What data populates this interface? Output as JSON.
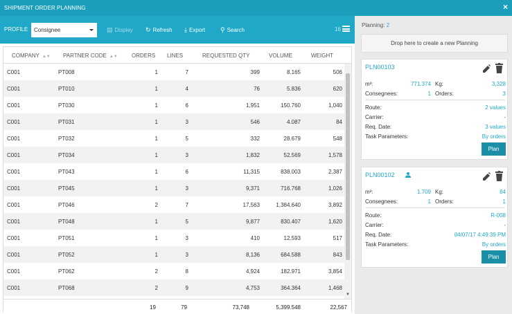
{
  "window": {
    "title": "SHIPMENT ORDER PLANNING",
    "close_label": "×"
  },
  "toolbar": {
    "profile_label": "PROFILE",
    "profile_value": "Consignee",
    "display_label": "Display",
    "refresh_label": "Refresh",
    "export_label": "Export",
    "search_label": "Search",
    "count": "16"
  },
  "table": {
    "columns": [
      "COMPANY",
      "PARTNER CODE",
      "ORDERS",
      "LINES",
      "REQUESTED QTY",
      "VOLUME",
      "WEIGHT"
    ],
    "rows": [
      [
        "C001",
        "PT008",
        "1",
        "7",
        "399",
        "8.165",
        "506"
      ],
      [
        "C001",
        "PT010",
        "1",
        "4",
        "76",
        "5.836",
        "620"
      ],
      [
        "C001",
        "PT030",
        "1",
        "6",
        "1,951",
        "150.760",
        "1,040"
      ],
      [
        "C001",
        "PT031",
        "1",
        "3",
        "546",
        "4.087",
        "84"
      ],
      [
        "C001",
        "PT032",
        "1",
        "5",
        "332",
        "28.679",
        "548"
      ],
      [
        "C001",
        "PT034",
        "1",
        "3",
        "1,832",
        "52.569",
        "1,578"
      ],
      [
        "C001",
        "PT043",
        "1",
        "6",
        "11,315",
        "838.003",
        "2,387"
      ],
      [
        "C001",
        "PT045",
        "1",
        "3",
        "9,371",
        "716.768",
        "1,026"
      ],
      [
        "C001",
        "PT046",
        "2",
        "7",
        "17,563",
        "1,384.640",
        "3,892"
      ],
      [
        "C001",
        "PT048",
        "1",
        "5",
        "9,877",
        "830.407",
        "1,620"
      ],
      [
        "C001",
        "PT051",
        "1",
        "3",
        "410",
        "12.593",
        "517"
      ],
      [
        "C001",
        "PT052",
        "1",
        "3",
        "8,136",
        "684.588",
        "843"
      ],
      [
        "C001",
        "PT062",
        "2",
        "8",
        "4,924",
        "182.971",
        "3,854"
      ],
      [
        "C001",
        "PT068",
        "2",
        "9",
        "4,753",
        "364.364",
        "1,468"
      ]
    ],
    "totals": {
      "orders": "19",
      "lines": "79",
      "requested_qty": "73,748",
      "volume": "5,399.548",
      "weight": "22,567"
    }
  },
  "planning": {
    "label": "Planning:",
    "count": "2",
    "dropzone": "Drop here to create a new Planning",
    "cards": [
      {
        "id": "PLN00103",
        "m3_label": "m³:",
        "m3": "771.374",
        "kg_label": "Kg:",
        "kg": "3,328",
        "consignees_label": "Consegnees:",
        "consignees": "1",
        "orders_label": "Orders:",
        "orders": "3",
        "route_label": "Route:",
        "route": "2 values",
        "carrier_label": "Carrier:",
        "carrier": "-",
        "reqdate_label": "Req. Date:",
        "reqdate": "3 values",
        "task_label": "Task Parameters:",
        "task": "By orders",
        "plan_label": "Plan"
      },
      {
        "id": "PLN00102",
        "m3_label": "m³:",
        "m3": "1.709",
        "kg_label": "Kg:",
        "kg": "84",
        "consignees_label": "Consegnees:",
        "consignees": "1",
        "orders_label": "Orders:",
        "orders": "1",
        "route_label": "Route:",
        "route": "R-008",
        "carrier_label": "Carrier:",
        "carrier": "-",
        "reqdate_label": "Req. Date:",
        "reqdate": "04/07/17 4:49:39 PM",
        "task_label": "Task Parameters:",
        "task": "By orders",
        "plan_label": "Plan"
      }
    ]
  },
  "colors": {
    "header": "#1b9fbd",
    "toolbar": "#1fa8c8",
    "accent": "#1fa8c8",
    "plan_button": "#1b8fa8"
  },
  "icons": [
    "close-icon",
    "list-icon",
    "refresh-icon",
    "download-icon",
    "search-icon",
    "menu-icon",
    "sort-icon",
    "edit-icon",
    "trash-icon",
    "user-icon"
  ]
}
